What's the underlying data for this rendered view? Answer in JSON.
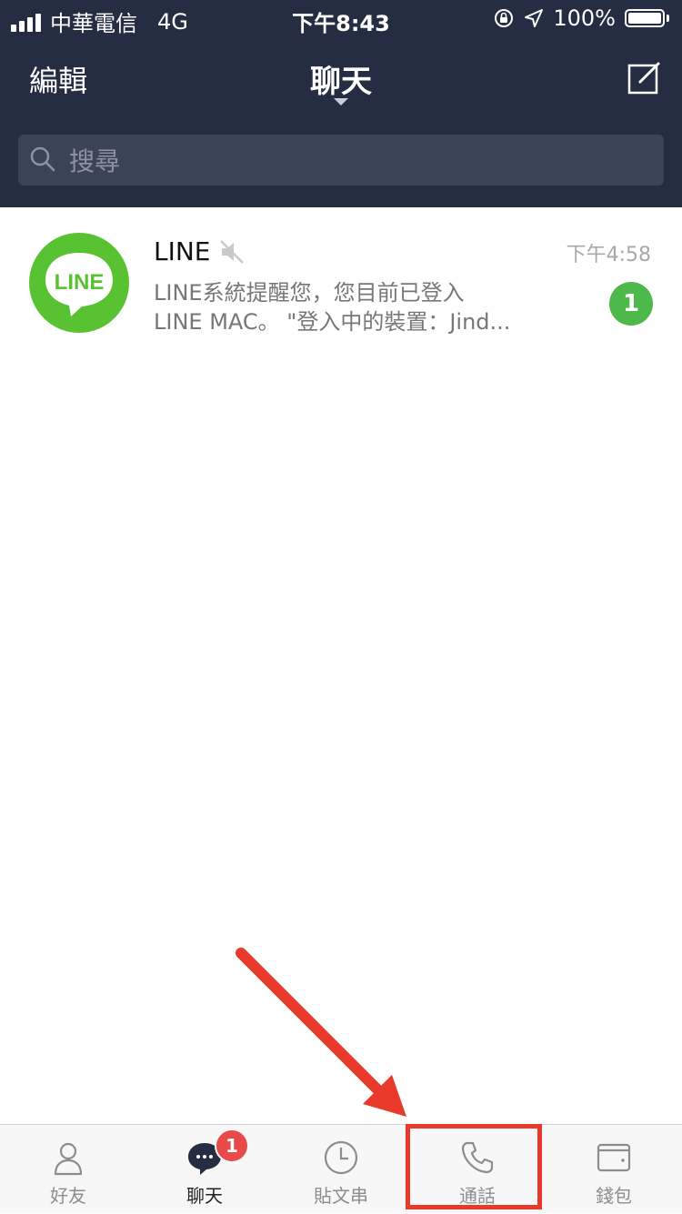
{
  "status_bar": {
    "carrier": "中華電信",
    "network": "4G",
    "time": "下午8:43",
    "battery": "100%"
  },
  "header": {
    "edit_label": "編輯",
    "title": "聊天"
  },
  "search": {
    "placeholder": "搜尋"
  },
  "chats": [
    {
      "name": "LINE",
      "time": "下午4:58",
      "preview_line1": "LINE系統提醒您，您目前已登入",
      "preview_line2": "LINE MAC。 \"登入中的裝置：Jind...",
      "unread": "1",
      "muted": true,
      "avatar_text": "LINE"
    }
  ],
  "tabs": [
    {
      "label": "好友",
      "icon": "friends-icon"
    },
    {
      "label": "聊天",
      "icon": "chat-icon",
      "badge": "1",
      "active": true
    },
    {
      "label": "貼文串",
      "icon": "clock-icon"
    },
    {
      "label": "通話",
      "icon": "phone-icon",
      "highlighted": true
    },
    {
      "label": "錢包",
      "icon": "wallet-icon"
    }
  ],
  "colors": {
    "header_bg": "#252d42",
    "line_green": "#59c232",
    "unread_green": "#4cb94a",
    "badge_red": "#e84a4a",
    "annotation_red": "#e8392a"
  }
}
